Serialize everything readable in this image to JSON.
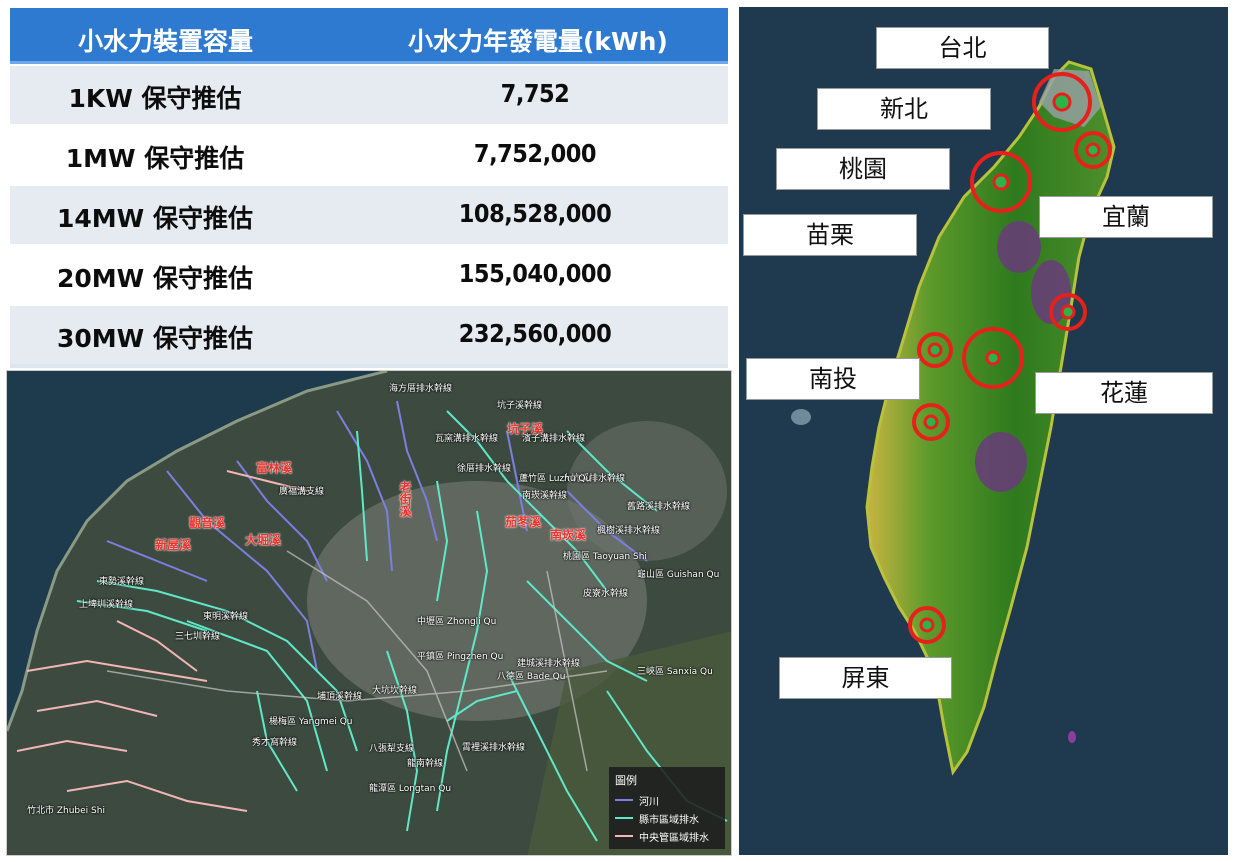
{
  "capacity_table": {
    "header_capacity": "小水力裝置容量",
    "header_generation": "小水力年發電量(kWh)",
    "rows": [
      {
        "capacity": "1KW  保守推估",
        "generation": "7,752"
      },
      {
        "capacity": "1MW  保守推估",
        "generation": "7,752,000"
      },
      {
        "capacity": "14MW 保守推估",
        "generation": "108,528,000"
      },
      {
        "capacity": "20MW 保守推估",
        "generation": "155,040,000"
      },
      {
        "capacity": "30MW 保守推估",
        "generation": "232,560,000"
      }
    ]
  },
  "taiwan_map": {
    "cities": [
      "台北",
      "新北",
      "桃園",
      "苗栗",
      "宜蘭",
      "南投",
      "花蓮",
      "屏東"
    ],
    "marker_color": "#e8201c"
  },
  "drainage_map": {
    "rivers": [
      "富林溪",
      "觀音溪",
      "新屋溪",
      "大堀溪",
      "老街溪",
      "坑子溪",
      "茄苳溪",
      "南崁溪"
    ],
    "channels": [
      "海方厝排水幹線",
      "坑子溪幹線",
      "瓦窯溝排水幹線",
      "濱子溝排水幹線",
      "徐厝排水幹線",
      "大坑溪排水幹線",
      "廣福溝支線",
      "南崁溪幹線",
      "楓樹溪排水幹線",
      "舊路溪排水幹線",
      "東勢溪幹線",
      "上埤圳溪幹線",
      "東明溪幹線",
      "三七圳幹線",
      "埔頂溪幹線",
      "大坑坎幹線",
      "建城溪排水幹線",
      "八張犁支線",
      "龍南幹線",
      "霄裡溪排水幹線",
      "秀才窩幹線",
      "皮寮水幹線"
    ],
    "places": [
      "中壢區 Zhongli Qu",
      "平鎮區 Pingzhen Qu",
      "桃園區 Taoyuan Shi",
      "蘆竹區 Luzhu Qu",
      "龜山區 Guishan Qu",
      "八德區 Bade Qu",
      "楊梅區 Yangmei Qu",
      "龍潭區 Longtan Qu",
      "竹北市 Zhubei Shi",
      "三峽區 Sanxia Qu"
    ],
    "legend": {
      "title": "圖例",
      "items": [
        {
          "label": "河川",
          "color": "#7b7fe0"
        },
        {
          "label": "縣市區域排水",
          "color": "#5fe8c8"
        },
        {
          "label": "中央管區域排水",
          "color": "#f2b6b6"
        }
      ]
    }
  }
}
